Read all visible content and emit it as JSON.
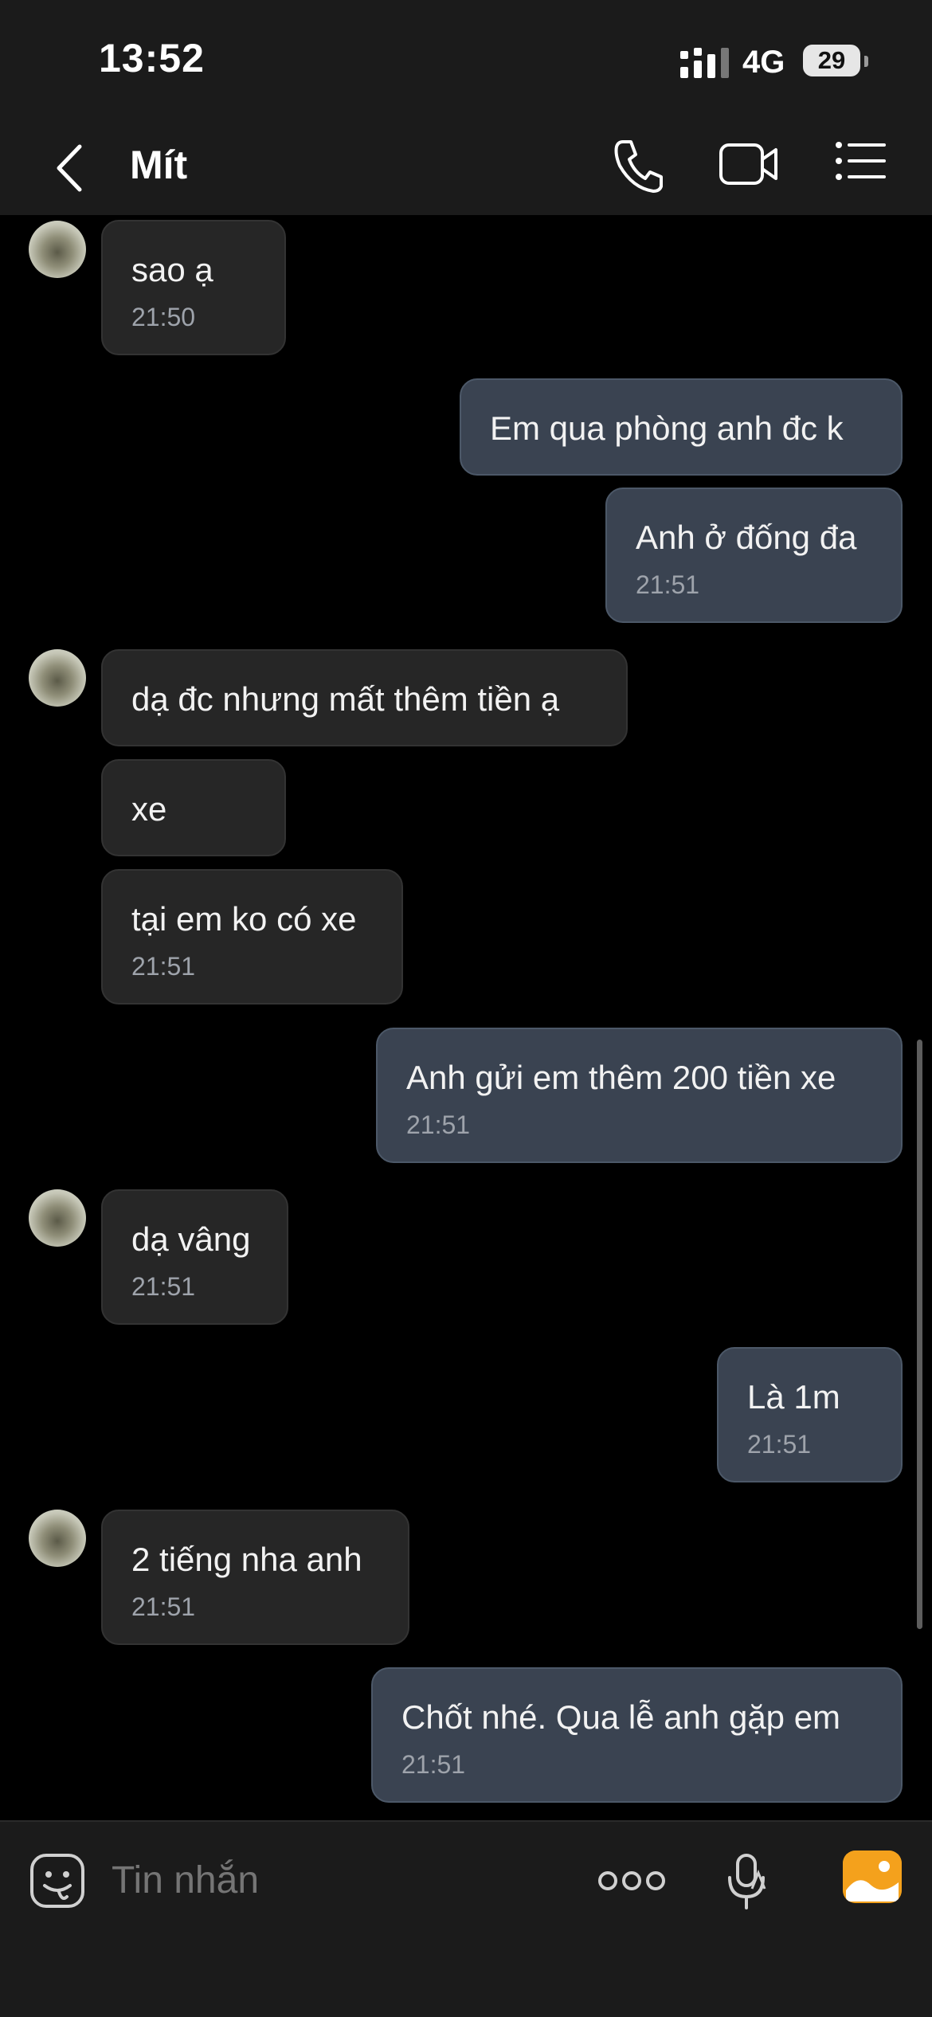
{
  "status": {
    "time": "13:52",
    "network": "4G",
    "battery": "29"
  },
  "header": {
    "contact_name": "Mít"
  },
  "messages": [
    {
      "dir": "in",
      "text": "sao ạ",
      "time": "21:50",
      "avatar": true
    },
    {
      "dir": "out",
      "text": "Em qua phòng anh đc k",
      "time": ""
    },
    {
      "dir": "out",
      "text": "Anh ở đống đa",
      "time": "21:51"
    },
    {
      "dir": "in",
      "text": "dạ đc nhưng mất thêm tiền ạ",
      "time": "",
      "avatar": true
    },
    {
      "dir": "in",
      "text": "xe",
      "time": ""
    },
    {
      "dir": "in",
      "text": "tại em ko có xe",
      "time": "21:51"
    },
    {
      "dir": "out",
      "text": "Anh gửi em thêm 200 tiền xe",
      "time": "21:51"
    },
    {
      "dir": "in",
      "text": "dạ vâng",
      "time": "21:51",
      "avatar": true
    },
    {
      "dir": "out",
      "text": "Là 1m",
      "time": "21:51"
    },
    {
      "dir": "in",
      "text": "2 tiếng nha anh",
      "time": "21:51",
      "avatar": true
    },
    {
      "dir": "out",
      "text": "Chốt nhé. Qua lễ anh gặp em",
      "time": "21:51"
    }
  ],
  "composer": {
    "placeholder": "Tin nhắn"
  },
  "colors": {
    "accent_orange": "#f4a11c",
    "outgoing_bubble": "#3a4351",
    "incoming_bubble": "#262626"
  }
}
